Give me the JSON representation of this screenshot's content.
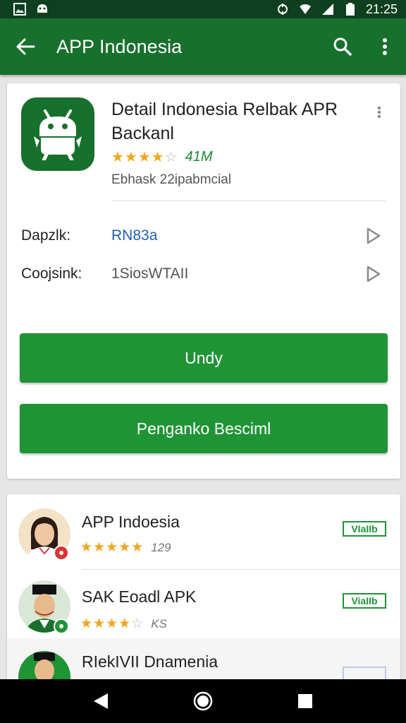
{
  "status_bar": {
    "time": "21:25"
  },
  "app_bar": {
    "title": "APP Indonesia"
  },
  "detail": {
    "title": "Detail Indonesia Relbak APR Backanl",
    "rating_count": "41M",
    "stars": 3.5,
    "subtitle": "Ebhask 22ipabmcial",
    "rows": [
      {
        "label": "Dapzlk:",
        "value": "RN83a"
      },
      {
        "label": "Coojsink:",
        "value": "1SiosWTAII"
      }
    ],
    "primary_button": "Undy",
    "secondary_button": "Penganko Besciml"
  },
  "list": {
    "items": [
      {
        "name": "APP Indoesia",
        "count": "129",
        "stars": 4.5,
        "badge": "VIaIIb"
      },
      {
        "name": "SAK Eoadl APK",
        "count": "KS",
        "stars": 4.0,
        "badge": "ViaIIb"
      },
      {
        "name": "RIekIVII Dnamenia",
        "badge": ""
      }
    ]
  },
  "colors": {
    "primary": "#17702c",
    "button": "#1f9435",
    "star": "#f3a51c",
    "link": "#1f5fb3"
  }
}
